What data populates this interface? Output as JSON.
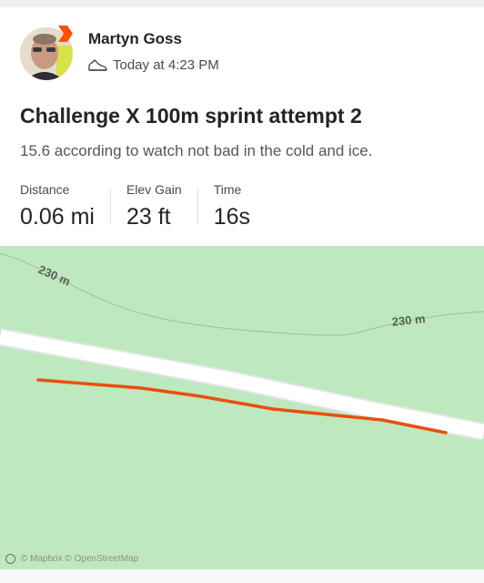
{
  "activity": {
    "athlete_name": "Martyn Goss",
    "timestamp": "Today at 4:23 PM",
    "activity_type_icon": "shoe-icon",
    "title": "Challenge X 100m sprint attempt 2",
    "description": "15.6 according to watch not bad in the cold and ice.",
    "stats": [
      {
        "label": "Distance",
        "value": "0.06 mi"
      },
      {
        "label": "Elev Gain",
        "value": "23 ft"
      },
      {
        "label": "Time",
        "value": "16s"
      }
    ]
  },
  "map": {
    "contour_labels": [
      "230 m",
      "230 m"
    ],
    "attribution": "© Mapbox © OpenStreetMap",
    "colors": {
      "land": "#bee9bf",
      "road": "#ffffff",
      "route": "#e8500e"
    }
  }
}
